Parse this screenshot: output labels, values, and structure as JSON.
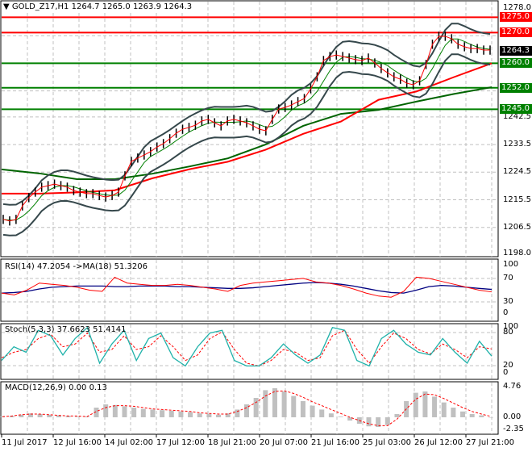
{
  "header": {
    "symbol": "GOLD_Z17,H1",
    "ohlc": "1264.7 1265.0 1263.9 1264.3"
  },
  "colors": {
    "resistance": "#ff0000",
    "support": "#008000",
    "bands": "#36484c",
    "ma_fast": "#ff0000",
    "ma_slow": "#006400",
    "rsi": "#ff0000",
    "rsi_ma": "#000080",
    "stoch_k": "#20b2aa",
    "stoch_d": "#ff0000",
    "macd_hist": "#c0c0c0",
    "macd_signal": "#ff0000"
  },
  "levels": [
    {
      "label": "1275.0",
      "value": 1275.0,
      "kind": "resistance"
    },
    {
      "label": "1270.0",
      "value": 1270.0,
      "kind": "resistance"
    },
    {
      "label": "1260.0",
      "value": 1260.0,
      "kind": "support"
    },
    {
      "label": "1252.0",
      "value": 1252.0,
      "kind": "support"
    },
    {
      "label": "1245.0",
      "value": 1245.0,
      "kind": "support"
    }
  ],
  "current_price": "1264.3",
  "price_axis": [
    "1278.0",
    "1269.0",
    "1260.0",
    "1251.0",
    "1242.5",
    "1233.5",
    "1224.5",
    "1215.5",
    "1206.5",
    "1198.0"
  ],
  "rsi": {
    "title": "RSI(14) 47.2054  ->MA(18) 51.3206",
    "ticks": [
      "100",
      "70",
      "30",
      "0"
    ]
  },
  "stoch": {
    "title": "Stoch(5,3,3) 37.6623 51.4141",
    "ticks": [
      "100",
      "80",
      "20",
      "0"
    ]
  },
  "macd": {
    "title": "MACD(12,26,9) 0.00 0.13",
    "ticks": [
      "4.76",
      "0.00",
      "-2.35"
    ]
  },
  "time_axis": [
    "11 Jul 2017",
    "12 Jul 16:00",
    "14 Jul 02:00",
    "17 Jul 12:00",
    "18 Jul 21:00",
    "20 Jul 07:00",
    "21 Jul 16:00",
    "25 Jul 03:00",
    "26 Jul 12:00",
    "27 Jul 21:00"
  ],
  "chart_data": {
    "type": "line",
    "title": "GOLD_Z17,H1",
    "ylim": [
      1198,
      1278
    ],
    "close": [
      1209.1,
      1208.6,
      1209.1,
      1213.5,
      1216.2,
      1218.0,
      1219.6,
      1220.1,
      1220.6,
      1220.1,
      1219.6,
      1218.5,
      1218.0,
      1217.5,
      1217.5,
      1216.9,
      1216.4,
      1216.9,
      1218.0,
      1223.3,
      1228.0,
      1229.1,
      1230.1,
      1231.2,
      1232.7,
      1233.8,
      1235.4,
      1237.2,
      1238.5,
      1239.1,
      1239.8,
      1241.2,
      1241.7,
      1240.6,
      1239.6,
      1241.2,
      1241.7,
      1241.2,
      1240.6,
      1239.6,
      1238.5,
      1238.0,
      1241.7,
      1245.1,
      1245.6,
      1246.4,
      1247.5,
      1248.5,
      1251.7,
      1255.6,
      1260.9,
      1262.2,
      1262.7,
      1262.2,
      1261.7,
      1261.2,
      1260.9,
      1261.7,
      1260.1,
      1258.3,
      1256.9,
      1255.6,
      1254.8,
      1253.5,
      1253.0,
      1254.3,
      1259.6,
      1266.2,
      1268.8,
      1268.8,
      1268.0,
      1266.2,
      1265.4,
      1264.8,
      1264.8,
      1264.3,
      1264.3
    ],
    "ma_fast": [
      1217.5,
      1217.5,
      1217.9,
      1218.6,
      1222.5,
      1225.5,
      1227.9,
      1231.8,
      1237.0,
      1241.0,
      1248.1,
      1250.8,
      1255.5,
      1260.0
    ],
    "ma_slow": [
      1225.4,
      1224.1,
      1222.2,
      1222.2,
      1224.0,
      1226.4,
      1229.0,
      1233.5,
      1239.6,
      1243.5,
      1244.8,
      1247.5,
      1250.0,
      1252.2
    ],
    "rsi": [
      45,
      42,
      50,
      62,
      60,
      58,
      55,
      50,
      48,
      72,
      62,
      60,
      58,
      58,
      60,
      58,
      55,
      52,
      48,
      58,
      62,
      64,
      66,
      68,
      70,
      64,
      62,
      58,
      52,
      45,
      40,
      38,
      48,
      72,
      70,
      65,
      60,
      55,
      50,
      47
    ],
    "rsi_ma": [
      45,
      46,
      48,
      52,
      55,
      56,
      57,
      57,
      57,
      56,
      56,
      57,
      57,
      57,
      56,
      56,
      55,
      54,
      53,
      53,
      54,
      56,
      58,
      60,
      62,
      63,
      62,
      60,
      57,
      53,
      49,
      46,
      45,
      50,
      56,
      58,
      57,
      55,
      53,
      51.3
    ],
    "stoch_k": [
      30,
      55,
      45,
      85,
      75,
      40,
      70,
      90,
      25,
      60,
      85,
      30,
      70,
      80,
      35,
      20,
      55,
      80,
      85,
      30,
      20,
      20,
      35,
      60,
      40,
      25,
      40,
      90,
      85,
      30,
      20,
      70,
      85,
      60,
      45,
      40,
      70,
      45,
      25,
      65,
      38
    ],
    "stoch_d": [
      35,
      45,
      50,
      70,
      78,
      55,
      60,
      80,
      45,
      50,
      75,
      50,
      55,
      75,
      55,
      30,
      40,
      70,
      82,
      50,
      25,
      20,
      30,
      50,
      45,
      30,
      35,
      75,
      85,
      50,
      25,
      55,
      80,
      70,
      50,
      42,
      60,
      50,
      35,
      55,
      51
    ],
    "macd_hist": [
      0.1,
      0.2,
      0.4,
      0.6,
      0.5,
      0.4,
      0.3,
      0.2,
      0.1,
      0.1,
      1.5,
      2.0,
      1.9,
      1.7,
      1.5,
      1.3,
      1.2,
      1.1,
      1.0,
      0.9,
      0.8,
      0.6,
      0.5,
      0.4,
      0.6,
      1.2,
      2.0,
      3.0,
      4.2,
      4.5,
      4.0,
      3.3,
      2.5,
      1.8,
      1.2,
      0.6,
      0.1,
      -0.5,
      -1.0,
      -1.4,
      -1.5,
      -1.2,
      0.5,
      2.5,
      3.8,
      4.0,
      3.2,
      2.3,
      1.5,
      0.9,
      0.5,
      0.3,
      0.0
    ],
    "macd_signal": [
      0.1,
      0.2,
      0.4,
      0.5,
      0.5,
      0.4,
      0.3,
      0.2,
      0.2,
      0.1,
      0.9,
      1.5,
      1.8,
      1.8,
      1.7,
      1.5,
      1.3,
      1.2,
      1.1,
      1.0,
      0.9,
      0.7,
      0.6,
      0.5,
      0.5,
      0.9,
      1.5,
      2.3,
      3.3,
      4.0,
      4.1,
      3.7,
      3.1,
      2.4,
      1.8,
      1.2,
      0.6,
      0.0,
      -0.5,
      -1.0,
      -1.3,
      -1.3,
      -0.3,
      1.3,
      2.8,
      3.6,
      3.5,
      2.9,
      2.2,
      1.5,
      0.9,
      0.5,
      0.13
    ]
  }
}
